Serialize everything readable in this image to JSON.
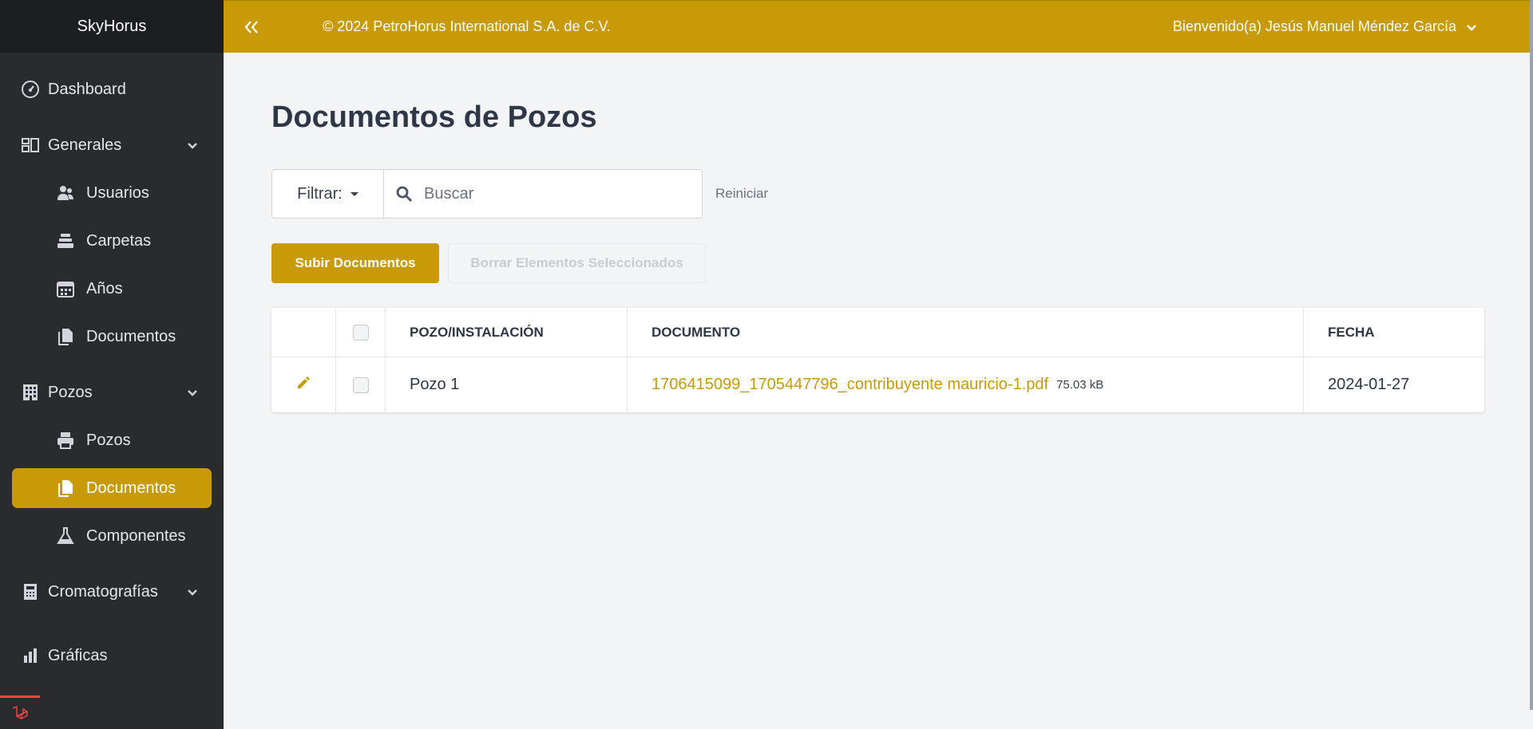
{
  "app": {
    "brand": "SkyHorus"
  },
  "topbar": {
    "copyright": "© 2024 PetroHorus International S.A. de C.V.",
    "user_greeting": "Bienvenido(a) Jesús Manuel Méndez García"
  },
  "sidebar": {
    "items": [
      {
        "label": "Dashboard",
        "icon": "dashboard-icon"
      },
      {
        "label": "Generales",
        "icon": "generales-icon",
        "expandable": true
      },
      {
        "label": "Usuarios",
        "icon": "users-icon"
      },
      {
        "label": "Carpetas",
        "icon": "folders-icon"
      },
      {
        "label": "Años",
        "icon": "calendar-icon"
      },
      {
        "label": "Documentos",
        "icon": "documents-icon"
      },
      {
        "label": "Pozos",
        "icon": "building-icon",
        "expandable": true
      },
      {
        "label": "Pozos",
        "icon": "printer-icon"
      },
      {
        "label": "Documentos",
        "icon": "documents-icon",
        "active": true
      },
      {
        "label": "Componentes",
        "icon": "flask-icon"
      },
      {
        "label": "Cromatografías",
        "icon": "calculator-icon",
        "expandable": true
      },
      {
        "label": "Gráficas",
        "icon": "chart-icon"
      }
    ]
  },
  "main": {
    "title": "Documentos de Pozos",
    "filter_label": "Filtrar:",
    "search_placeholder": "Buscar",
    "reset_label": "Reiniciar",
    "upload_label": "Subir Documentos",
    "delete_label": "Borrar Elementos Seleccionados"
  },
  "table": {
    "columns": [
      "POZO/INSTALACIÓN",
      "DOCUMENTO",
      "FECHA"
    ],
    "rows": [
      {
        "pozo": "Pozo 1",
        "documento": "1706415099_1705447796_contribuyente mauricio-1.pdf",
        "size": "75.03 kB",
        "fecha": "2024-01-27"
      }
    ]
  },
  "colors": {
    "accent": "#c99a07",
    "sidebar": "#2a2b2e",
    "background": "#f3f4f6"
  }
}
